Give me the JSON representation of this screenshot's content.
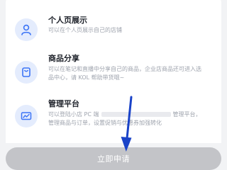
{
  "features": [
    {
      "title": "个人页展示",
      "desc": "可以在个人页展示自己的店铺",
      "icon": "person-icon"
    },
    {
      "title": "商品分享",
      "desc": "可以在笔记和直播中分享自己的商品，企业店商品还可进入选品中心，请 KOL 帮助带货哦~",
      "icon": "shopping-bag-icon"
    },
    {
      "title": "管理平台",
      "desc_before": "可以登陆小店 PC 端",
      "desc_after": "管理平台，管理商品与订单，设置促销与优惠券加强转化",
      "icon": "chart-monitor-icon"
    }
  ],
  "cta": {
    "label": "立即申请"
  },
  "colors": {
    "accent": "#3c74f6",
    "icon_bg": "#e4ecfd",
    "disabled_button": "#c3c4c8",
    "arrow": "#1a43c8"
  }
}
